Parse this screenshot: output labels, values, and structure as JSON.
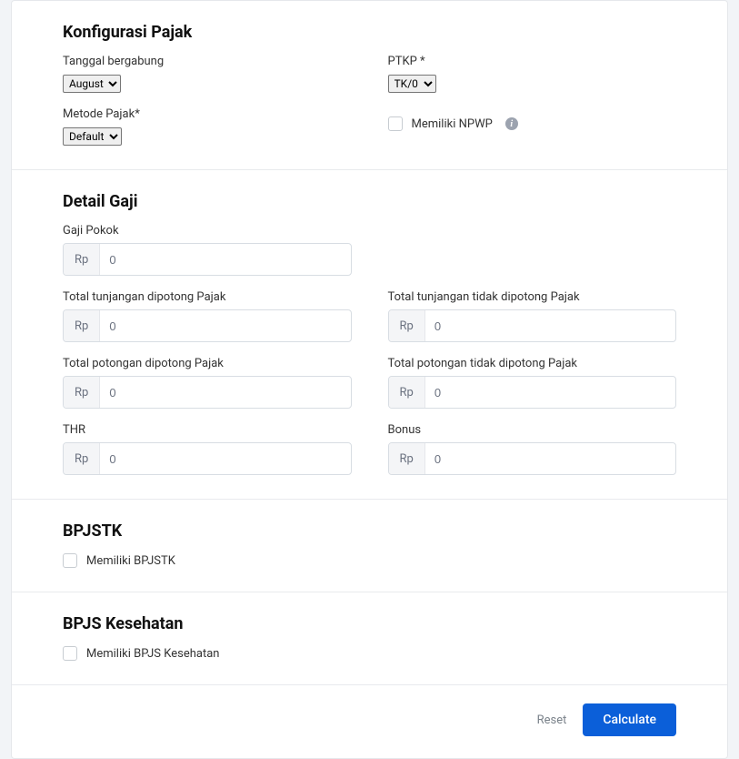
{
  "tax": {
    "title": "Konfigurasi Pajak",
    "joinDate": {
      "label": "Tanggal bergabung",
      "value": "August"
    },
    "taxMethod": {
      "label": "Metode Pajak*",
      "value": "Default"
    },
    "ptkp": {
      "label": "PTKP *",
      "value": "TK/0"
    },
    "npwp": {
      "label": "Memiliki NPWP"
    }
  },
  "salary": {
    "title": "Detail Gaji",
    "currency": "Rp",
    "base": {
      "label": "Gaji Pokok",
      "value": "0"
    },
    "allowTax": {
      "label": "Total tunjangan dipotong Pajak",
      "value": "0"
    },
    "allowNoTax": {
      "label": "Total tunjangan tidak dipotong Pajak",
      "value": "0"
    },
    "deductTax": {
      "label": "Total potongan dipotong Pajak",
      "value": "0"
    },
    "deductNoTax": {
      "label": "Total potongan tidak dipotong Pajak",
      "value": "0"
    },
    "thr": {
      "label": "THR",
      "value": "0"
    },
    "bonus": {
      "label": "Bonus",
      "value": "0"
    }
  },
  "bpjstk": {
    "title": "BPJSTK",
    "checkbox": "Memiliki BPJSTK"
  },
  "bpjsHealth": {
    "title": "BPJS Kesehatan",
    "checkbox": "Memiliki BPJS Kesehatan"
  },
  "footer": {
    "reset": "Reset",
    "calculate": "Calculate"
  }
}
